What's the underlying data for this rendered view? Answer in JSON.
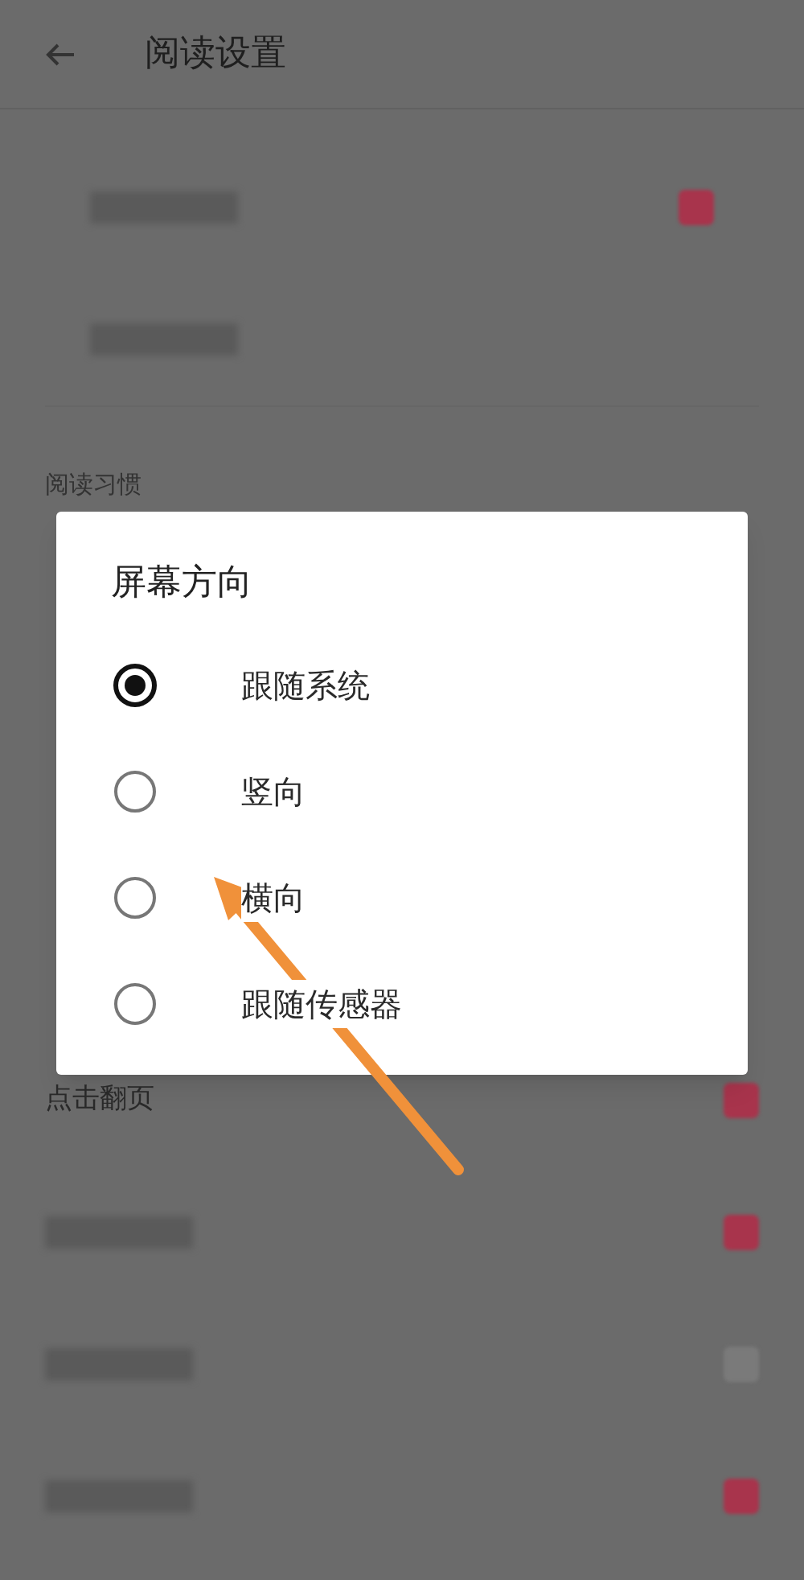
{
  "header": {
    "title": "阅读设置"
  },
  "top_rows": [
    {
      "kind": "blurred",
      "toggle": true
    },
    {
      "kind": "blurred"
    }
  ],
  "section": {
    "label": "阅读习惯"
  },
  "bottom_rows": [
    {
      "kind": "text",
      "label": "点击翻页",
      "toggle": true
    },
    {
      "kind": "blurred",
      "toggle": true
    },
    {
      "kind": "blurred",
      "toggle": false
    },
    {
      "kind": "blurred",
      "toggle": true
    }
  ],
  "dialog": {
    "title": "屏幕方向",
    "options": [
      {
        "label": "跟随系统",
        "selected": true
      },
      {
        "label": "竖向",
        "selected": false
      },
      {
        "label": "横向",
        "selected": false
      },
      {
        "label": "跟随传感器",
        "selected": false
      }
    ]
  }
}
